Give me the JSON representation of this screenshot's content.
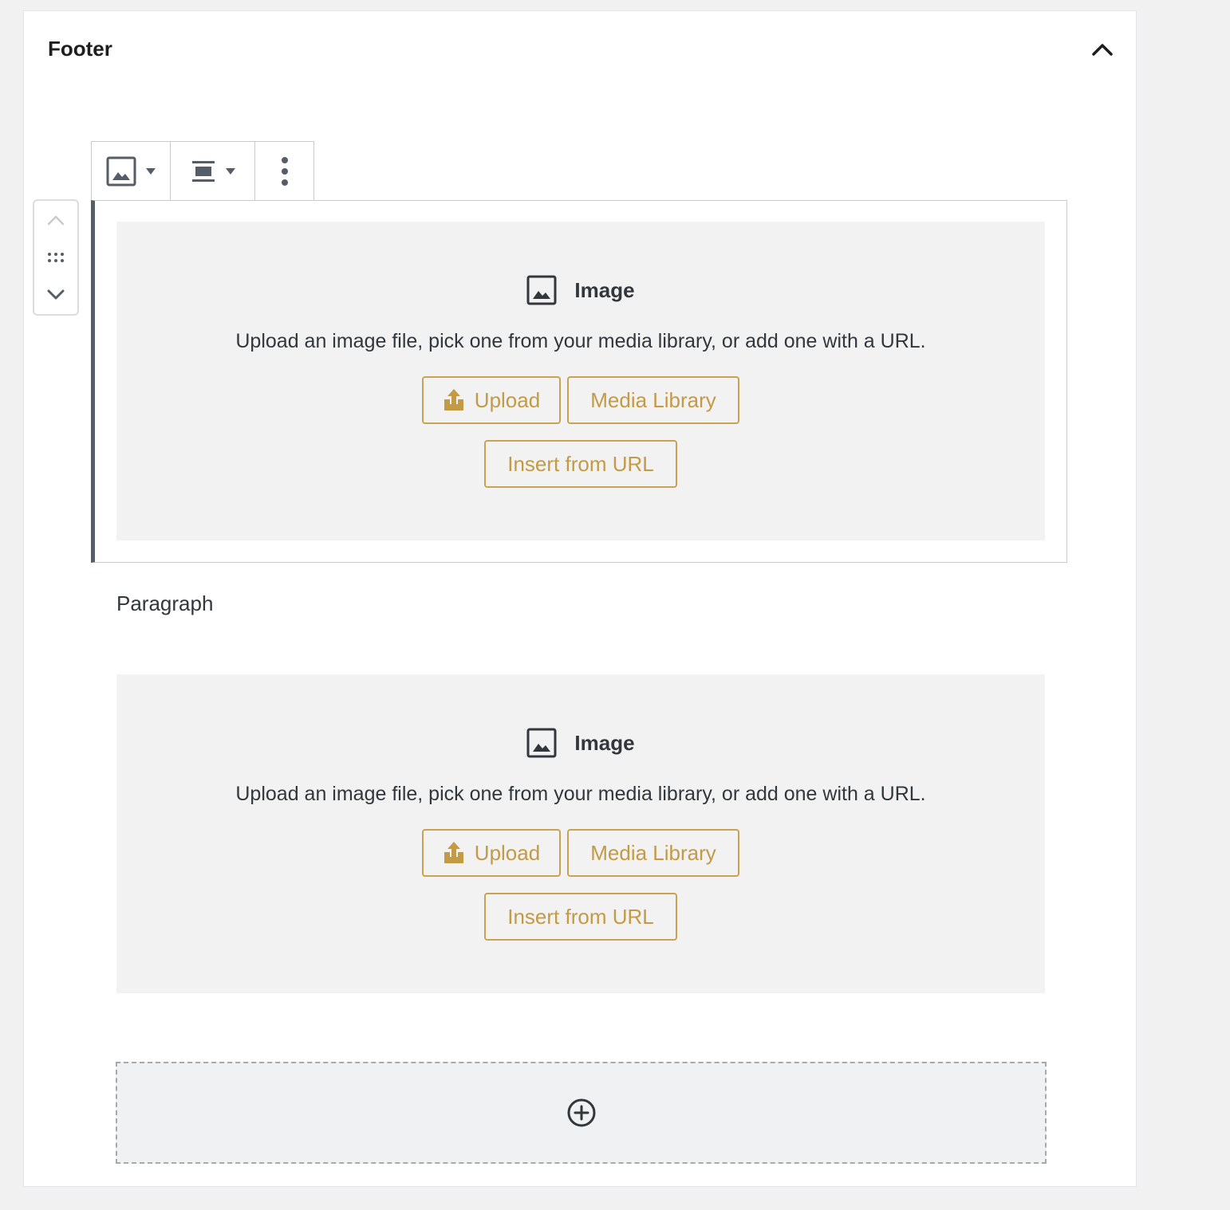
{
  "panel": {
    "title": "Footer",
    "collapse_icon": "chevron-up-icon"
  },
  "toolbar": {
    "block_type_icon": "image-icon",
    "align_icon": "align-center-icon",
    "more_icon": "more-vertical-icon",
    "dropdown_icon": "caret-down-icon"
  },
  "mover": {
    "up_icon": "chevron-up-icon",
    "drag_icon": "drag-handle-icon",
    "down_icon": "chevron-down-icon"
  },
  "blocks": [
    {
      "label": "Image",
      "instructions": "Upload an image file, pick one from your media library, or add one with a URL.",
      "upload_label": "Upload",
      "media_library_label": "Media Library",
      "insert_url_label": "Insert from URL"
    },
    {
      "label": "Image",
      "instructions": "Upload an image file, pick one from your media library, or add one with a URL.",
      "upload_label": "Upload",
      "media_library_label": "Media Library",
      "insert_url_label": "Insert from URL"
    }
  ],
  "paragraph": {
    "text": "Paragraph"
  },
  "appender": {
    "icon": "plus-circle-icon"
  },
  "colors": {
    "accent": "#c39a46",
    "placeholder_bg": "#f2f2f2",
    "selected_border": "#555d66"
  }
}
